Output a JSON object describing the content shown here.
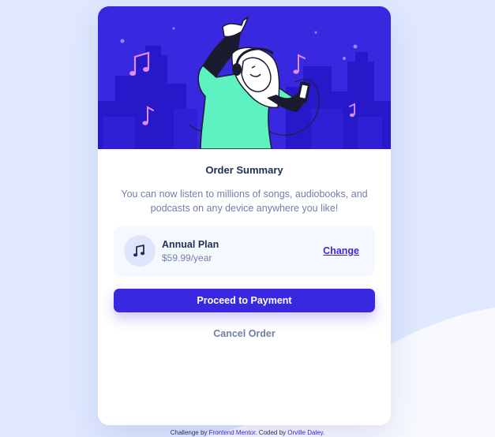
{
  "colors": {
    "background": "#e0e8ff",
    "accent": "#3829e0",
    "heading": "#1f2f56",
    "muted": "#717fa6",
    "plan_bg": "#f5f8ff"
  },
  "hero": {
    "illustration": "person-with-headphones-dancing-illustration",
    "icons": [
      "music-note-icon",
      "music-note-icon",
      "music-note-icon",
      "music-note-icon"
    ]
  },
  "card": {
    "title": "Order Summary",
    "description": "You can now listen to millions of songs, audiobooks, and podcasts on any device anywhere you like!",
    "plan": {
      "icon": "music-note-icon",
      "name": "Annual Plan",
      "price": "$59.99/year",
      "change_label": "Change"
    },
    "pay_label": "Proceed to Payment",
    "cancel_label": "Cancel Order"
  },
  "attribution": {
    "prefix": "Challenge by",
    "link1": "Frontend Mentor",
    "middle": ". Coded by",
    "link2": "Orville Daley",
    "suffix": "."
  }
}
